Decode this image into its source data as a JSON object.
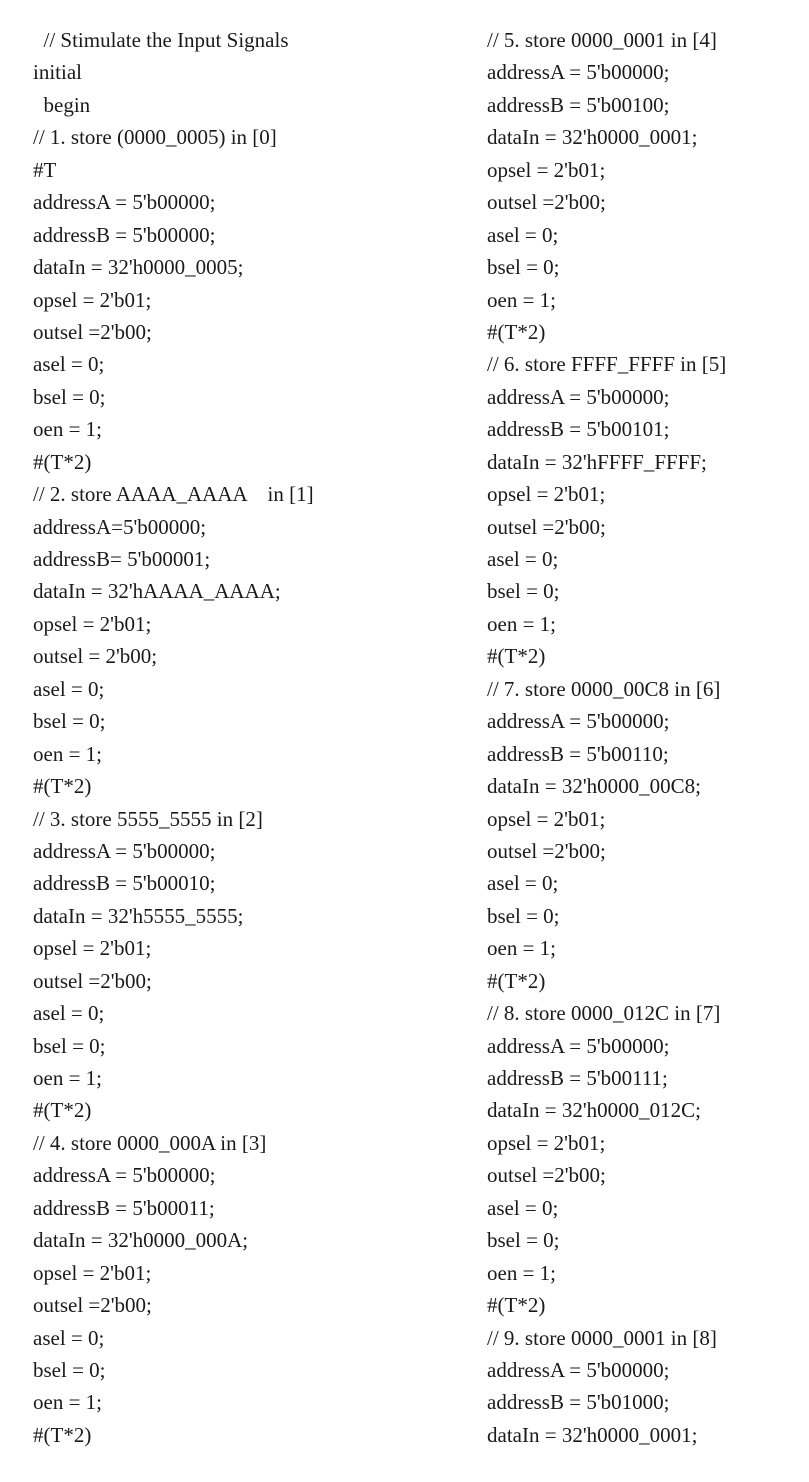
{
  "document": {
    "left_column": [
      "  // Stimulate the Input Signals",
      "initial",
      "  begin",
      "// 1. store (0000_0005) in [0]",
      "#T",
      "addressA = 5'b00000;",
      "addressB = 5'b00000;",
      "dataIn = 32'h0000_0005;",
      "opsel = 2'b01;",
      "outsel =2'b00;",
      "asel = 0;",
      "bsel = 0;",
      "oen = 1;",
      "#(T*2)",
      "// 2. store AAAA_AAAA    in [1]",
      "addressA=5'b00000;",
      "addressB= 5'b00001;",
      "dataIn = 32'hAAAA_AAAA;",
      "opsel = 2'b01;",
      "outsel = 2'b00;",
      "asel = 0;",
      "bsel = 0;",
      "oen = 1;",
      "#(T*2)",
      "// 3. store 5555_5555 in [2]",
      "addressA = 5'b00000;",
      "addressB = 5'b00010;",
      "dataIn = 32'h5555_5555;",
      "opsel = 2'b01;",
      "outsel =2'b00;",
      "asel = 0;",
      "bsel = 0;",
      "oen = 1;",
      "#(T*2)",
      "// 4. store 0000_000A in [3]",
      "addressA = 5'b00000;",
      "addressB = 5'b00011;",
      "dataIn = 32'h0000_000A;",
      "opsel = 2'b01;",
      "outsel =2'b00;",
      "asel = 0;",
      "bsel = 0;",
      "oen = 1;",
      "#(T*2)"
    ],
    "right_column": [
      "// 5. store 0000_0001 in [4]",
      "addressA = 5'b00000;",
      "addressB = 5'b00100;",
      "dataIn = 32'h0000_0001;",
      "opsel = 2'b01;",
      "outsel =2'b00;",
      "asel = 0;",
      "bsel = 0;",
      "oen = 1;",
      "#(T*2)",
      "// 6. store FFFF_FFFF in [5]",
      "addressA = 5'b00000;",
      "addressB = 5'b00101;",
      "dataIn = 32'hFFFF_FFFF;",
      "opsel = 2'b01;",
      "outsel =2'b00;",
      "asel = 0;",
      "bsel = 0;",
      "oen = 1;",
      "#(T*2)",
      "// 7. store 0000_00C8 in [6]",
      "addressA = 5'b00000;",
      "addressB = 5'b00110;",
      "dataIn = 32'h0000_00C8;",
      "opsel = 2'b01;",
      "outsel =2'b00;",
      "asel = 0;",
      "bsel = 0;",
      "oen = 1;",
      "#(T*2)",
      "// 8. store 0000_012C in [7]",
      "addressA = 5'b00000;",
      "addressB = 5'b00111;",
      "dataIn = 32'h0000_012C;",
      "opsel = 2'b01;",
      "outsel =2'b00;",
      "asel = 0;",
      "bsel = 0;",
      "oen = 1;",
      "#(T*2)",
      "// 9. store 0000_0001 in [8]",
      "addressA = 5'b00000;",
      "addressB = 5'b01000;",
      "dataIn = 32'h0000_0001;"
    ]
  }
}
